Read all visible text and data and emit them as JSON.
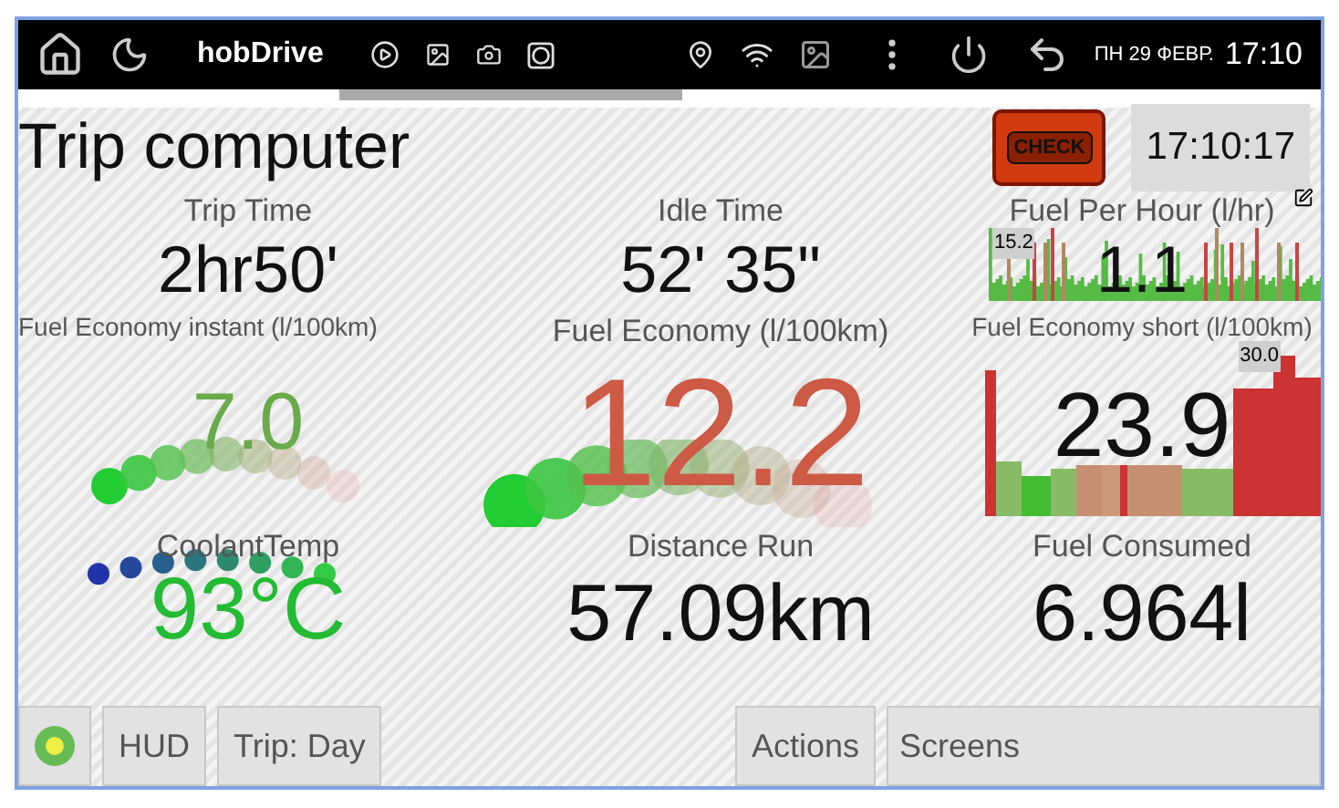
{
  "status_bar": {
    "app_name": "hobDrive",
    "date": "ПН 29 ФЕВР.",
    "time": "17:10"
  },
  "header": {
    "title": "Trip computer",
    "check_engine_label": "CHECK",
    "clock": "17:10:17"
  },
  "tiles": [
    {
      "kind": "text",
      "title": "Trip Time",
      "value": "2hr50'",
      "color": "#111111"
    },
    {
      "kind": "text",
      "title": "Idle Time",
      "value": "52' 35\"",
      "color": "#111111"
    },
    {
      "kind": "spike-chart",
      "title": "Fuel Per Hour (l/hr)",
      "value": "1.1",
      "peak": "15.2",
      "color": "#111111"
    },
    {
      "kind": "gauge",
      "title": "Fuel Economy instant (l/100km)",
      "value": "7.0",
      "color": "#6aaa4a"
    },
    {
      "kind": "big-gauge",
      "title": "Fuel Economy (l/100km)",
      "value": "12.2",
      "color": "#cc5a44"
    },
    {
      "kind": "area-chart",
      "title": "Fuel Economy short (l/100km)",
      "value": "23.9",
      "peak": "30.0",
      "color": "#111111"
    },
    {
      "kind": "temp-gauge",
      "title": "CoolantTemp",
      "value": "93°C",
      "color": "#22bb33"
    },
    {
      "kind": "text",
      "title": "Distance Run",
      "value": "57.09km",
      "color": "#111111"
    },
    {
      "kind": "text",
      "title": "Fuel Consumed",
      "value": "6.964l",
      "color": "#111111"
    }
  ],
  "bottom_bar": {
    "buttons": [
      {
        "label": "HUD",
        "kind": "button"
      },
      {
        "label": "Trip: Day",
        "kind": "button"
      },
      {
        "kind": "spacer"
      },
      {
        "label": "Actions",
        "kind": "button"
      },
      {
        "label": "Screens",
        "kind": "wide"
      }
    ]
  }
}
